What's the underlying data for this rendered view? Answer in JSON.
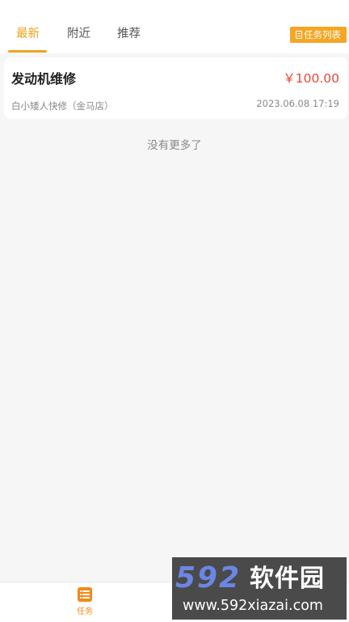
{
  "tabs": [
    {
      "label": "最新",
      "active": true
    },
    {
      "label": "附近",
      "active": false
    },
    {
      "label": "推荐",
      "active": false
    }
  ],
  "task_list_button": {
    "label": "任务列表",
    "icon": "document-icon"
  },
  "tasks": [
    {
      "title": "发动机维修",
      "price": "￥100.00",
      "shop": "白小矮人快修（金马店）",
      "time": "2023.06.08 17:19"
    }
  ],
  "no_more_text": "没有更多了",
  "bottom_nav": [
    {
      "label": "任务",
      "icon": "task-list-icon",
      "active": true
    }
  ],
  "watermark": {
    "logo": "592",
    "name": "软件园",
    "url": "www.592xiazai.com"
  },
  "colors": {
    "accent": "#f0a21c",
    "button": "#f5a623",
    "price": "#e5473a",
    "nav_accent": "#f08a1c",
    "background": "#f6f6f6"
  }
}
